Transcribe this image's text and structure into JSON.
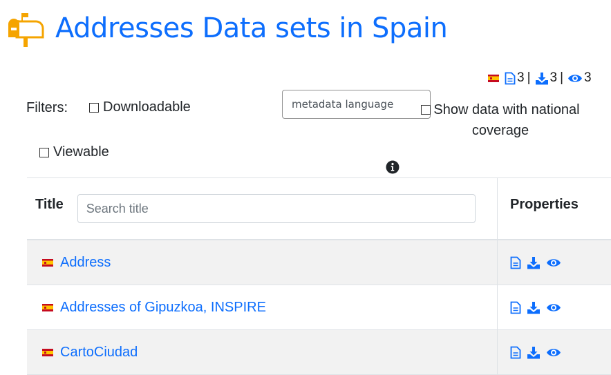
{
  "page": {
    "title": "Addresses  Data sets in Spain",
    "icon": "mailbox-icon",
    "accent_color": "#0d6efd",
    "icon_color": "#f5a400"
  },
  "stats": {
    "flag": "spain-flag-icon",
    "metadata_count": "3",
    "download_count": "3",
    "view_count": "3",
    "separator": "|"
  },
  "filters": {
    "label": "Filters:",
    "downloadable": "Downloadable",
    "viewable": "Viewable",
    "language_select": "metadata language",
    "national_coverage": "Show data with national coverage"
  },
  "table": {
    "columns": {
      "title": "Title",
      "properties": "Properties"
    },
    "search_placeholder": "Search title",
    "rows": [
      {
        "title": "Address"
      },
      {
        "title": "Addresses of Gipuzkoa, INSPIRE"
      },
      {
        "title": "CartoCiudad"
      }
    ]
  }
}
